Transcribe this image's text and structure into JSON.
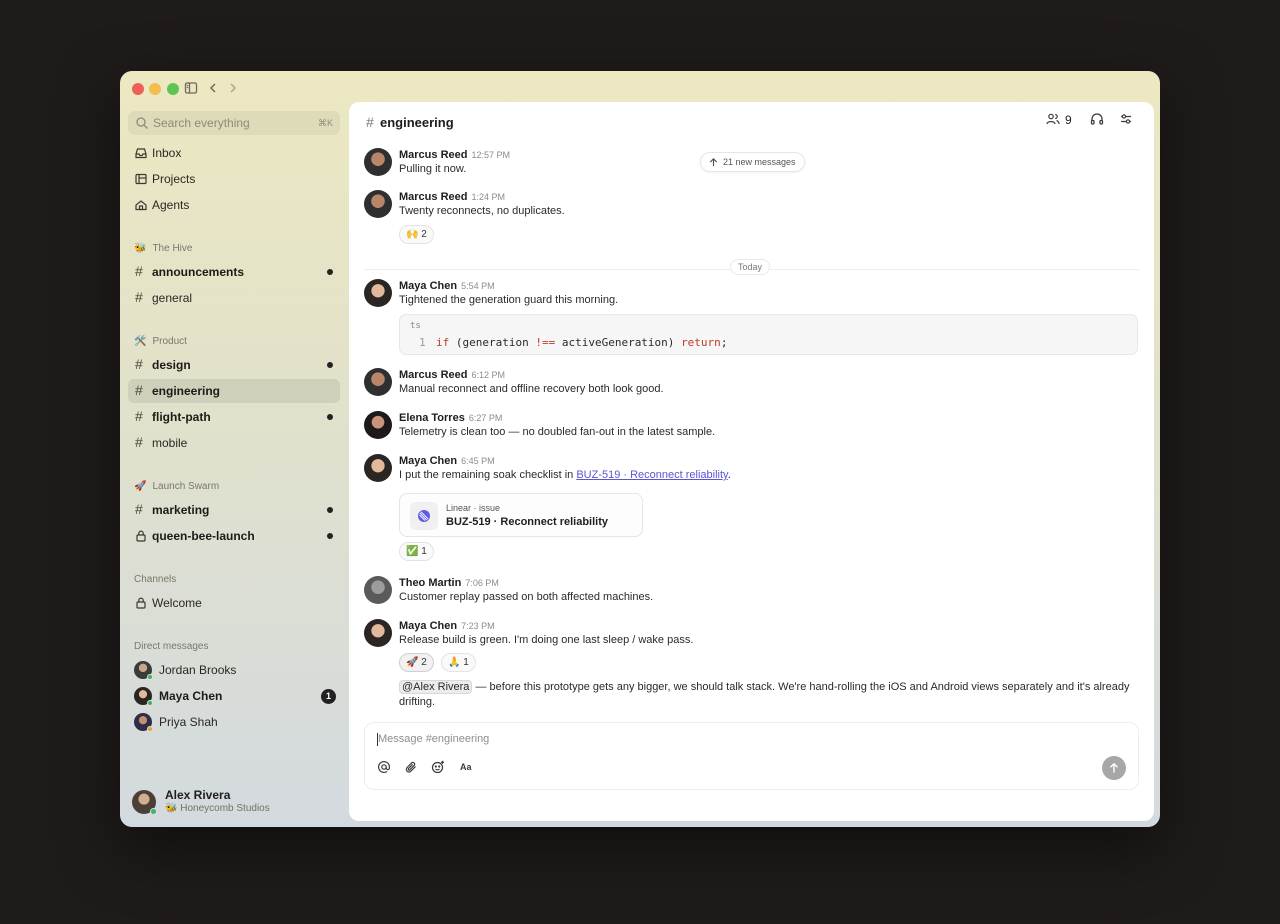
{
  "search": {
    "placeholder": "Search everything",
    "shortcut": "⌘K"
  },
  "nav": {
    "inbox": "Inbox",
    "projects": "Projects",
    "agents": "Agents"
  },
  "groups": [
    {
      "name": "The Hive",
      "emoji": "🐝",
      "channels": [
        {
          "name": "announcements",
          "unread": true
        },
        {
          "name": "general",
          "unread": false
        }
      ]
    },
    {
      "name": "Product",
      "emoji": "🛠️",
      "channels": [
        {
          "name": "design",
          "unread": true
        },
        {
          "name": "engineering",
          "unread": false,
          "active": true
        },
        {
          "name": "flight-path",
          "unread": true
        },
        {
          "name": "mobile",
          "unread": false
        }
      ]
    },
    {
      "name": "Launch Swarm",
      "emoji": "🚀",
      "channels": [
        {
          "name": "marketing",
          "unread": true
        },
        {
          "name": "queen-bee-launch",
          "unread": true,
          "locked": true
        }
      ]
    }
  ],
  "channels_section": {
    "title": "Channels",
    "items": [
      {
        "name": "Welcome",
        "locked": true
      }
    ]
  },
  "dm_section": {
    "title": "Direct messages",
    "items": [
      {
        "name": "Jordan Brooks",
        "status": "online"
      },
      {
        "name": "Maya Chen",
        "badge": "1",
        "status": "online"
      },
      {
        "name": "Priya Shah",
        "status": "away"
      }
    ]
  },
  "current_user": {
    "name": "Alex Rivera",
    "org": "🐝 Honeycomb Studios"
  },
  "channel": {
    "name": "engineering",
    "member_count": "9"
  },
  "new_messages": "21 new messages",
  "day_divider": "Today",
  "messages": [
    {
      "author": "Marcus Reed",
      "time": "12:57 PM",
      "text": "Pulling it now."
    },
    {
      "author": "Marcus Reed",
      "time": "1:24 PM",
      "text": "Twenty reconnects, no duplicates.",
      "reactions": [
        {
          "emoji": "🙌",
          "count": "2"
        }
      ]
    },
    {
      "author": "Maya Chen",
      "time": "5:54 PM",
      "text": "Tightened the generation guard this morning.",
      "code": {
        "lang": "ts",
        "line_no": "1",
        "kw1": "if",
        "cond1": " (generation ",
        "op": "!==",
        "cond2": " activeGeneration) ",
        "kw2": "return",
        "end": ";"
      }
    },
    {
      "author": "Marcus Reed",
      "time": "6:12 PM",
      "text": "Manual reconnect and offline recovery both look good."
    },
    {
      "author": "Elena Torres",
      "time": "6:27 PM",
      "text": "Telemetry is clean too — no doubled fan-out in the latest sample."
    },
    {
      "author": "Maya Chen",
      "time": "6:45 PM",
      "text_before": "I put the remaining soak checklist in ",
      "link": "BUZ-519 · Reconnect reliability",
      "text_after": ".",
      "card": {
        "source": "Linear · issue",
        "title": "BUZ-519 · Reconnect reliability"
      },
      "reactions": [
        {
          "emoji": "✅",
          "count": "1"
        }
      ]
    },
    {
      "author": "Theo Martin",
      "time": "7:06 PM",
      "text": "Customer replay passed on both affected machines."
    },
    {
      "author": "Maya Chen",
      "time": "7:23 PM",
      "text": "Release build is green. I'm doing one last sleep / wake pass.",
      "reactions": [
        {
          "emoji": "🚀",
          "count": "2"
        },
        {
          "emoji": "🙏",
          "count": "1"
        }
      ],
      "followup": {
        "mention": "@Alex Rivera",
        "text": " — before this prototype gets any bigger, we should talk stack. We're hand-rolling the iOS and Android views separately and it's already drifting."
      }
    }
  ],
  "composer": {
    "placeholder": "Message #engineering",
    "format_label": "Aa"
  },
  "colors": {
    "accent_link": "#5a55d6",
    "online": "#3bb36b",
    "away": "#e0a43a",
    "unread_dot": "#222222"
  }
}
